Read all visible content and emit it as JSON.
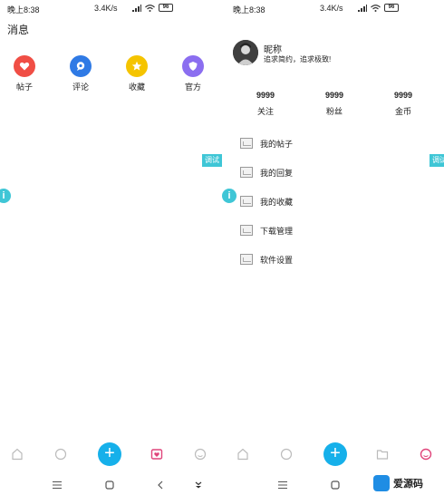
{
  "status_bar": {
    "time": "晚上8:38",
    "net_speed": "3.4K/s",
    "battery": "96"
  },
  "messages_page": {
    "title": "消息",
    "entries": [
      {
        "label": "帖子",
        "color": "#f04e45",
        "icon": "heart-icon"
      },
      {
        "label": "评论",
        "color": "#2f7ae5",
        "icon": "chat-icon"
      },
      {
        "label": "收藏",
        "color": "#f5c400",
        "icon": "star-icon"
      },
      {
        "label": "官方",
        "color": "#8b6ef0",
        "icon": "shield-icon"
      }
    ],
    "debug_tag": "调试"
  },
  "profile_page": {
    "nickname": "昵称",
    "signature": "追求简约，追求极致!",
    "stats": [
      {
        "value": "9999",
        "label": "关注"
      },
      {
        "value": "9999",
        "label": "粉丝"
      },
      {
        "value": "9999",
        "label": "金币"
      }
    ],
    "menu": [
      {
        "label": "我的帖子"
      },
      {
        "label": "我的回复"
      },
      {
        "label": "我的收藏"
      },
      {
        "label": "下载管理"
      },
      {
        "label": "软件设置"
      }
    ],
    "debug_tag": "调试"
  },
  "bottom_nav": {
    "add_label": "+",
    "accent_color": "#16b0ea"
  },
  "watermark": {
    "text": "爱源码"
  }
}
